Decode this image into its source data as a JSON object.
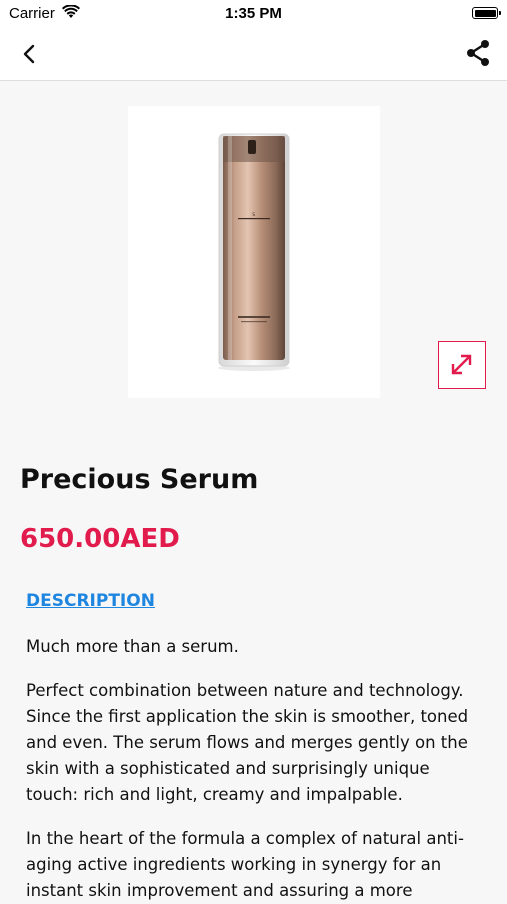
{
  "status_bar": {
    "carrier": "Carrier",
    "time": "1:35 PM"
  },
  "nav": {
    "back_icon": "chevron-left-icon",
    "share_icon": "share-icon"
  },
  "product": {
    "image_label": "product bottle image",
    "title": "Precious Serum",
    "price": "650.00AED",
    "expand_icon": "expand-arrows-icon"
  },
  "description": {
    "link_label": "DESCRIPTION",
    "paragraphs": [
      "Much more than a serum.",
      "Perfect combination between nature and technology. Since the first application the skin is smoother, toned and even. The serum flows and merges gently on the skin with a sophisticated and surprisingly unique touch: rich and light, creamy and impalpable.",
      "In the heart of the formula a complex of natural anti-aging active ingredients working in synergy for an instant skin improvement and assuring a more"
    ]
  },
  "colors": {
    "accent": "#e21b4d",
    "link": "#1f86e0",
    "background": "#f7f7f8"
  }
}
